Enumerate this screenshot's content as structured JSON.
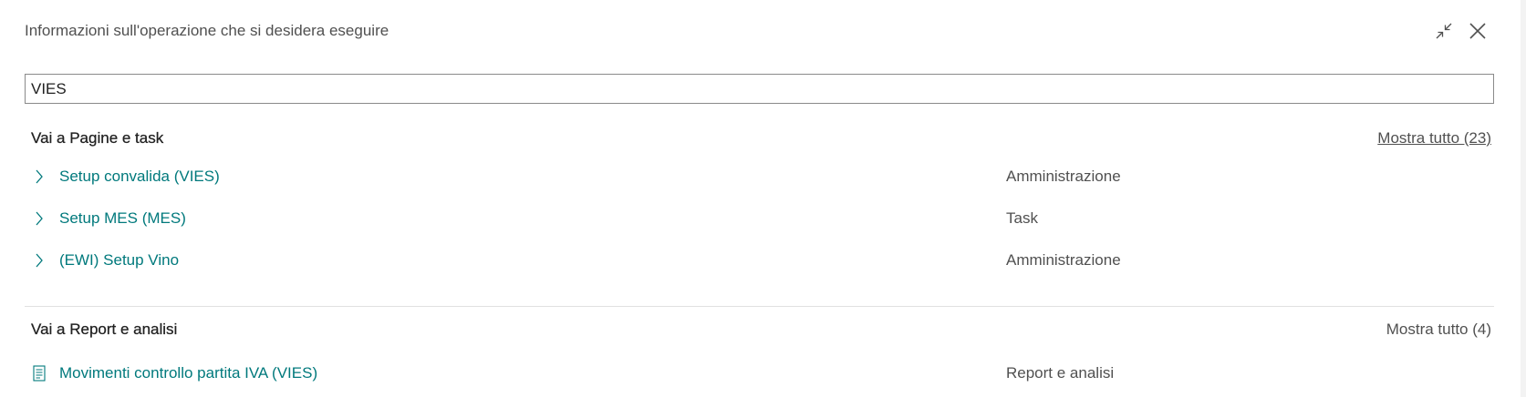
{
  "header": {
    "title": "Informazioni sull'operazione che si desidera eseguire",
    "collapse_icon": "collapse-icon",
    "close_icon": "close-icon"
  },
  "search": {
    "value": "VIES"
  },
  "sections": [
    {
      "title": "Vai a Pagine e task",
      "show_all": "Mostra tutto (23)",
      "items": [
        {
          "label": "Setup convalida (VIES)",
          "category": "Amministrazione",
          "icon": "chevron-right-icon"
        },
        {
          "label": "Setup MES (MES)",
          "category": "Task",
          "icon": "chevron-right-icon"
        },
        {
          "label": "(EWI) Setup Vino",
          "category": "Amministrazione",
          "icon": "chevron-right-icon"
        }
      ]
    },
    {
      "title": "Vai a Report e analisi",
      "show_all": "Mostra tutto (4)",
      "items": [
        {
          "label": "Movimenti controllo partita IVA (VIES)",
          "category": "Report e analisi",
          "icon": "report-icon"
        }
      ]
    }
  ],
  "colors": {
    "link": "#00797c",
    "text": "#212121",
    "muted": "#505050"
  }
}
